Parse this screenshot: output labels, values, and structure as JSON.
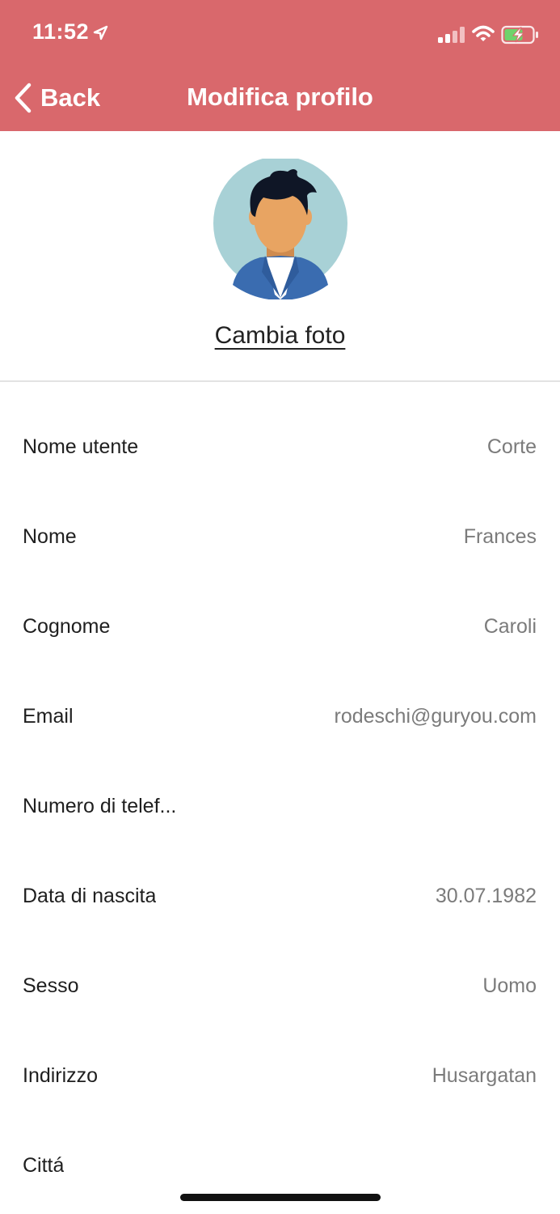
{
  "status_bar": {
    "time": "11:52"
  },
  "header": {
    "back_label": "Back",
    "title": "Modifica profilo"
  },
  "profile": {
    "change_photo_label": "Cambia foto"
  },
  "fields": [
    {
      "label": "Nome utente",
      "value": "Corte"
    },
    {
      "label": "Nome",
      "value": "Frances"
    },
    {
      "label": "Cognome",
      "value": "Caroli"
    },
    {
      "label": "Email",
      "value": "rodeschi@guryou.com"
    },
    {
      "label": "Numero di telef...",
      "value": ""
    },
    {
      "label": "Data di nascita",
      "value": "30.07.1982"
    },
    {
      "label": "Sesso",
      "value": "Uomo"
    },
    {
      "label": "Indirizzo",
      "value": "Husargatan"
    },
    {
      "label": "Cittá",
      "value": ""
    }
  ],
  "colors": {
    "header_background": "#d9686c",
    "header_text": "#ffffff",
    "label_text": "#1f1f1f",
    "value_text": "#7b7b7b",
    "avatar_background": "#a8d1d6",
    "jacket": "#3a6cb0",
    "skin": "#e8a462",
    "hair": "#0f1626"
  },
  "icons": {
    "location": "location-arrow-icon",
    "signal": "cellular-signal-icon",
    "wifi": "wifi-icon",
    "battery": "battery-charging-icon",
    "back": "chevron-left-icon"
  }
}
